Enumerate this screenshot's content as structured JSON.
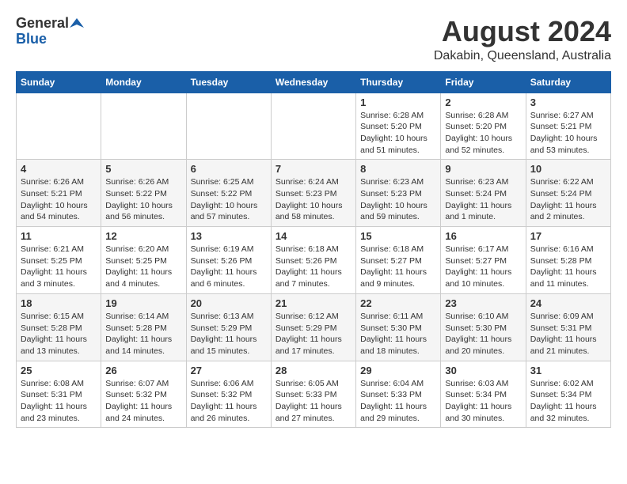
{
  "header": {
    "logo_general": "General",
    "logo_blue": "Blue",
    "month": "August 2024",
    "location": "Dakabin, Queensland, Australia"
  },
  "days_of_week": [
    "Sunday",
    "Monday",
    "Tuesday",
    "Wednesday",
    "Thursday",
    "Friday",
    "Saturday"
  ],
  "weeks": [
    [
      {
        "day": "",
        "sunrise": "",
        "sunset": "",
        "daylight": ""
      },
      {
        "day": "",
        "sunrise": "",
        "sunset": "",
        "daylight": ""
      },
      {
        "day": "",
        "sunrise": "",
        "sunset": "",
        "daylight": ""
      },
      {
        "day": "",
        "sunrise": "",
        "sunset": "",
        "daylight": ""
      },
      {
        "day": "1",
        "sunrise": "6:28 AM",
        "sunset": "5:20 PM",
        "daylight": "10 hours and 51 minutes."
      },
      {
        "day": "2",
        "sunrise": "6:28 AM",
        "sunset": "5:20 PM",
        "daylight": "10 hours and 52 minutes."
      },
      {
        "day": "3",
        "sunrise": "6:27 AM",
        "sunset": "5:21 PM",
        "daylight": "10 hours and 53 minutes."
      }
    ],
    [
      {
        "day": "4",
        "sunrise": "6:26 AM",
        "sunset": "5:21 PM",
        "daylight": "10 hours and 54 minutes."
      },
      {
        "day": "5",
        "sunrise": "6:26 AM",
        "sunset": "5:22 PM",
        "daylight": "10 hours and 56 minutes."
      },
      {
        "day": "6",
        "sunrise": "6:25 AM",
        "sunset": "5:22 PM",
        "daylight": "10 hours and 57 minutes."
      },
      {
        "day": "7",
        "sunrise": "6:24 AM",
        "sunset": "5:23 PM",
        "daylight": "10 hours and 58 minutes."
      },
      {
        "day": "8",
        "sunrise": "6:23 AM",
        "sunset": "5:23 PM",
        "daylight": "10 hours and 59 minutes."
      },
      {
        "day": "9",
        "sunrise": "6:23 AM",
        "sunset": "5:24 PM",
        "daylight": "11 hours and 1 minute."
      },
      {
        "day": "10",
        "sunrise": "6:22 AM",
        "sunset": "5:24 PM",
        "daylight": "11 hours and 2 minutes."
      }
    ],
    [
      {
        "day": "11",
        "sunrise": "6:21 AM",
        "sunset": "5:25 PM",
        "daylight": "11 hours and 3 minutes."
      },
      {
        "day": "12",
        "sunrise": "6:20 AM",
        "sunset": "5:25 PM",
        "daylight": "11 hours and 4 minutes."
      },
      {
        "day": "13",
        "sunrise": "6:19 AM",
        "sunset": "5:26 PM",
        "daylight": "11 hours and 6 minutes."
      },
      {
        "day": "14",
        "sunrise": "6:18 AM",
        "sunset": "5:26 PM",
        "daylight": "11 hours and 7 minutes."
      },
      {
        "day": "15",
        "sunrise": "6:18 AM",
        "sunset": "5:27 PM",
        "daylight": "11 hours and 9 minutes."
      },
      {
        "day": "16",
        "sunrise": "6:17 AM",
        "sunset": "5:27 PM",
        "daylight": "11 hours and 10 minutes."
      },
      {
        "day": "17",
        "sunrise": "6:16 AM",
        "sunset": "5:28 PM",
        "daylight": "11 hours and 11 minutes."
      }
    ],
    [
      {
        "day": "18",
        "sunrise": "6:15 AM",
        "sunset": "5:28 PM",
        "daylight": "11 hours and 13 minutes."
      },
      {
        "day": "19",
        "sunrise": "6:14 AM",
        "sunset": "5:28 PM",
        "daylight": "11 hours and 14 minutes."
      },
      {
        "day": "20",
        "sunrise": "6:13 AM",
        "sunset": "5:29 PM",
        "daylight": "11 hours and 15 minutes."
      },
      {
        "day": "21",
        "sunrise": "6:12 AM",
        "sunset": "5:29 PM",
        "daylight": "11 hours and 17 minutes."
      },
      {
        "day": "22",
        "sunrise": "6:11 AM",
        "sunset": "5:30 PM",
        "daylight": "11 hours and 18 minutes."
      },
      {
        "day": "23",
        "sunrise": "6:10 AM",
        "sunset": "5:30 PM",
        "daylight": "11 hours and 20 minutes."
      },
      {
        "day": "24",
        "sunrise": "6:09 AM",
        "sunset": "5:31 PM",
        "daylight": "11 hours and 21 minutes."
      }
    ],
    [
      {
        "day": "25",
        "sunrise": "6:08 AM",
        "sunset": "5:31 PM",
        "daylight": "11 hours and 23 minutes."
      },
      {
        "day": "26",
        "sunrise": "6:07 AM",
        "sunset": "5:32 PM",
        "daylight": "11 hours and 24 minutes."
      },
      {
        "day": "27",
        "sunrise": "6:06 AM",
        "sunset": "5:32 PM",
        "daylight": "11 hours and 26 minutes."
      },
      {
        "day": "28",
        "sunrise": "6:05 AM",
        "sunset": "5:33 PM",
        "daylight": "11 hours and 27 minutes."
      },
      {
        "day": "29",
        "sunrise": "6:04 AM",
        "sunset": "5:33 PM",
        "daylight": "11 hours and 29 minutes."
      },
      {
        "day": "30",
        "sunrise": "6:03 AM",
        "sunset": "5:34 PM",
        "daylight": "11 hours and 30 minutes."
      },
      {
        "day": "31",
        "sunrise": "6:02 AM",
        "sunset": "5:34 PM",
        "daylight": "11 hours and 32 minutes."
      }
    ]
  ]
}
